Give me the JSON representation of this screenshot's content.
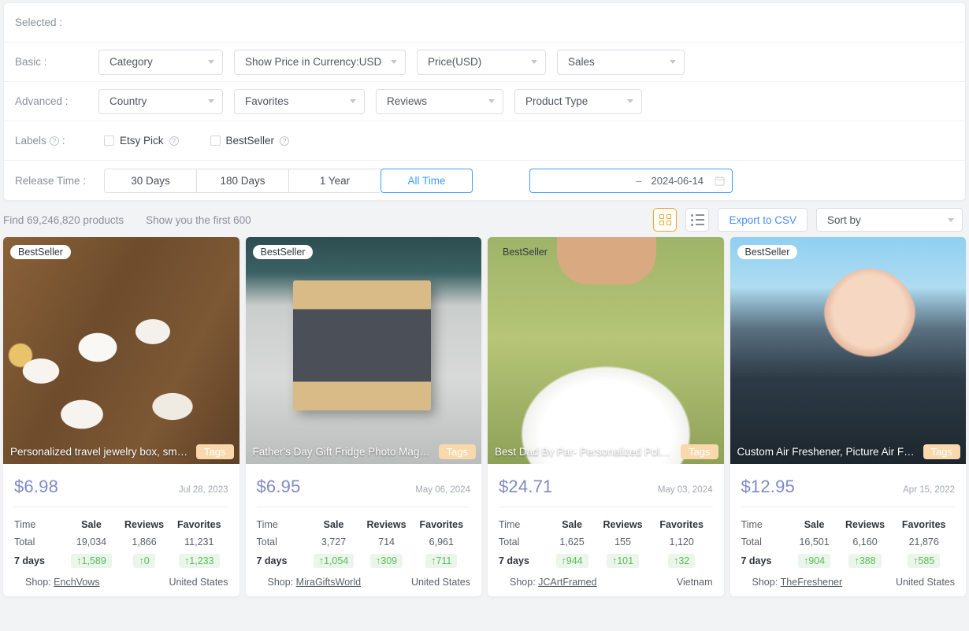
{
  "filters": {
    "selected_label": "Selected :",
    "basic_label": "Basic :",
    "advanced_label": "Advanced :",
    "labels_label": "Labels",
    "labels_colon": ":",
    "release_time_label": "Release Time :",
    "basic": [
      {
        "name": "category",
        "value": "Category"
      },
      {
        "name": "currency",
        "value": "Show Price in Currency:USD"
      },
      {
        "name": "price",
        "value": "Price(USD)"
      },
      {
        "name": "sales",
        "value": "Sales"
      }
    ],
    "advanced": [
      {
        "name": "country",
        "value": "Country"
      },
      {
        "name": "favorites",
        "value": "Favorites"
      },
      {
        "name": "reviews",
        "value": "Reviews"
      },
      {
        "name": "product-type",
        "value": "Product Type"
      }
    ],
    "checkboxes": [
      {
        "name": "etsy-pick",
        "label": "Etsy Pick",
        "checked": false
      },
      {
        "name": "bestseller",
        "label": "BestSeller",
        "checked": false
      }
    ],
    "release_time_options": [
      {
        "label": "30 Days",
        "active": false
      },
      {
        "label": "180 Days",
        "active": false
      },
      {
        "label": "1 Year",
        "active": false
      },
      {
        "label": "All Time",
        "active": true
      }
    ],
    "date_range": {
      "start": "",
      "start_placeholder": "",
      "separator": "–",
      "end": "2024-06-14",
      "icon": "calendar-icon"
    }
  },
  "toolbar": {
    "find_text": "Find 69,246,820 products",
    "show_text": "Show you the first 600",
    "grid_view_icon": "grid-view-icon",
    "list_view_icon": "list-view-icon",
    "export_label": "Export to CSV",
    "sort_label": "Sort by"
  },
  "colors": {
    "accent_blue": "#409eff",
    "link_blue": "#4c8bf5",
    "price_purple": "#7f8ac6",
    "active_orange": "#f5a623",
    "tags_peach": "#f9d8ab",
    "delta_green": "#5eb95e",
    "delta_green_bg": "#eaf6ea",
    "page_bg": "#f2f3f5"
  },
  "stats_headers": {
    "time": "Time",
    "sale": "Sale",
    "reviews": "Reviews",
    "favorites": "Favorites",
    "total_row": "Total",
    "days_row": "7 days",
    "shop_prefix": "Shop:",
    "tags_label": "Tags",
    "bestseller_label": "BestSeller"
  },
  "products": [
    {
      "title": "Personalized travel jewelry box, small ...",
      "bestseller": true,
      "bestseller_pill": true,
      "price": "$6.98",
      "date": "Jul 28, 2023",
      "total_sale": "19,034",
      "total_reviews": "1,866",
      "total_favorites": "11,231",
      "delta_sale": "↑1,589",
      "delta_reviews": "↑0",
      "delta_favorites": "↑1,233",
      "shop": "EnchVows",
      "country": "United States"
    },
    {
      "title": "Father's Day Gift Fridge Photo Magnet...",
      "bestseller": true,
      "bestseller_pill": true,
      "price": "$6.95",
      "date": "May 06, 2024",
      "total_sale": "3,727",
      "total_reviews": "714",
      "total_favorites": "6,961",
      "delta_sale": "↑1,054",
      "delta_reviews": "↑309",
      "delta_favorites": "↑711",
      "shop": "MiraGiftsWorld",
      "country": "United States"
    },
    {
      "title": "Best Dad By Par- Personalized Polo Sh...",
      "bestseller": true,
      "bestseller_pill": false,
      "price": "$24.71",
      "date": "May 03, 2024",
      "total_sale": "1,625",
      "total_reviews": "155",
      "total_favorites": "1,120",
      "delta_sale": "↑944",
      "delta_reviews": "↑101",
      "delta_favorites": "↑32",
      "shop": "JCArtFramed",
      "country": "Vietnam"
    },
    {
      "title": "Custom Air Freshener, Picture Air Fres...",
      "bestseller": true,
      "bestseller_pill": true,
      "price": "$12.95",
      "date": "Apr 15, 2022",
      "total_sale": "16,501",
      "total_reviews": "6,160",
      "total_favorites": "21,876",
      "delta_sale": "↑904",
      "delta_reviews": "↑388",
      "delta_favorites": "↑585",
      "shop": "TheFreshener",
      "country": "United States"
    }
  ]
}
